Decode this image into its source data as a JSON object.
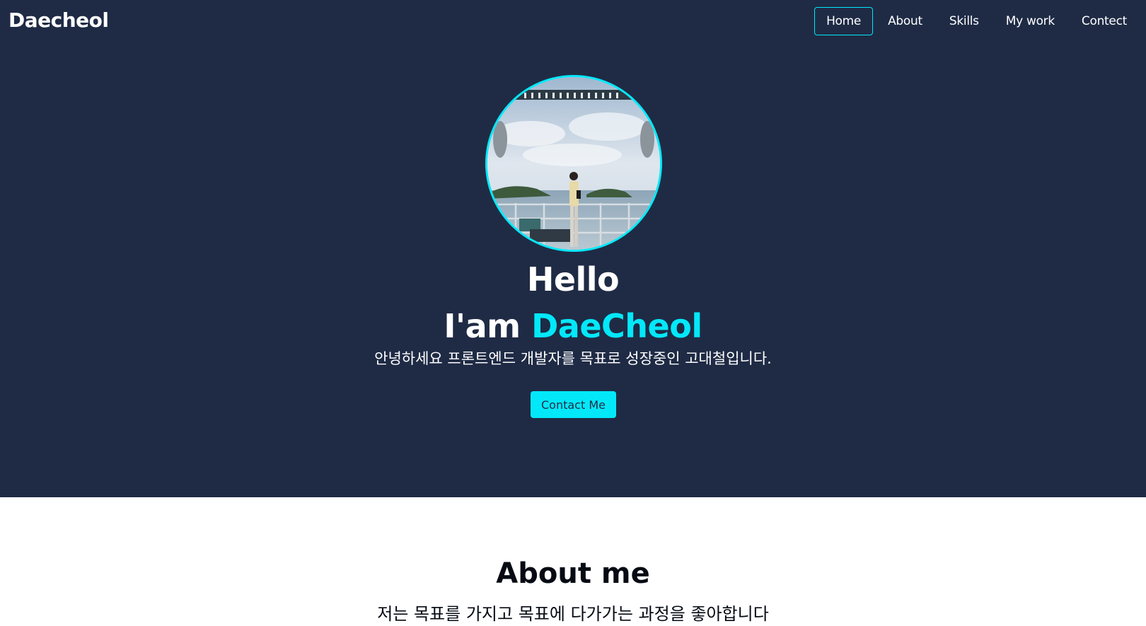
{
  "nav": {
    "logo": "Daecheol",
    "items": [
      {
        "label": "Home",
        "active": true
      },
      {
        "label": "About",
        "active": false
      },
      {
        "label": "Skills",
        "active": false
      },
      {
        "label": "My work",
        "active": false
      },
      {
        "label": "Contect",
        "active": false
      }
    ]
  },
  "hero": {
    "hello": "Hello",
    "iam_prefix": "I'am ",
    "name": "DaeCheol",
    "intro": "안녕하세요 프론트엔드 개발자를 목표로 성장중인 고대철입니다.",
    "contact_button": "Contact Me"
  },
  "about": {
    "title": "About me",
    "description": "저는 목표를 가지고 목표에 다가가는 과정을 좋아합니다"
  },
  "colors": {
    "background": "#1f2b45",
    "accent": "#03e8f9"
  }
}
